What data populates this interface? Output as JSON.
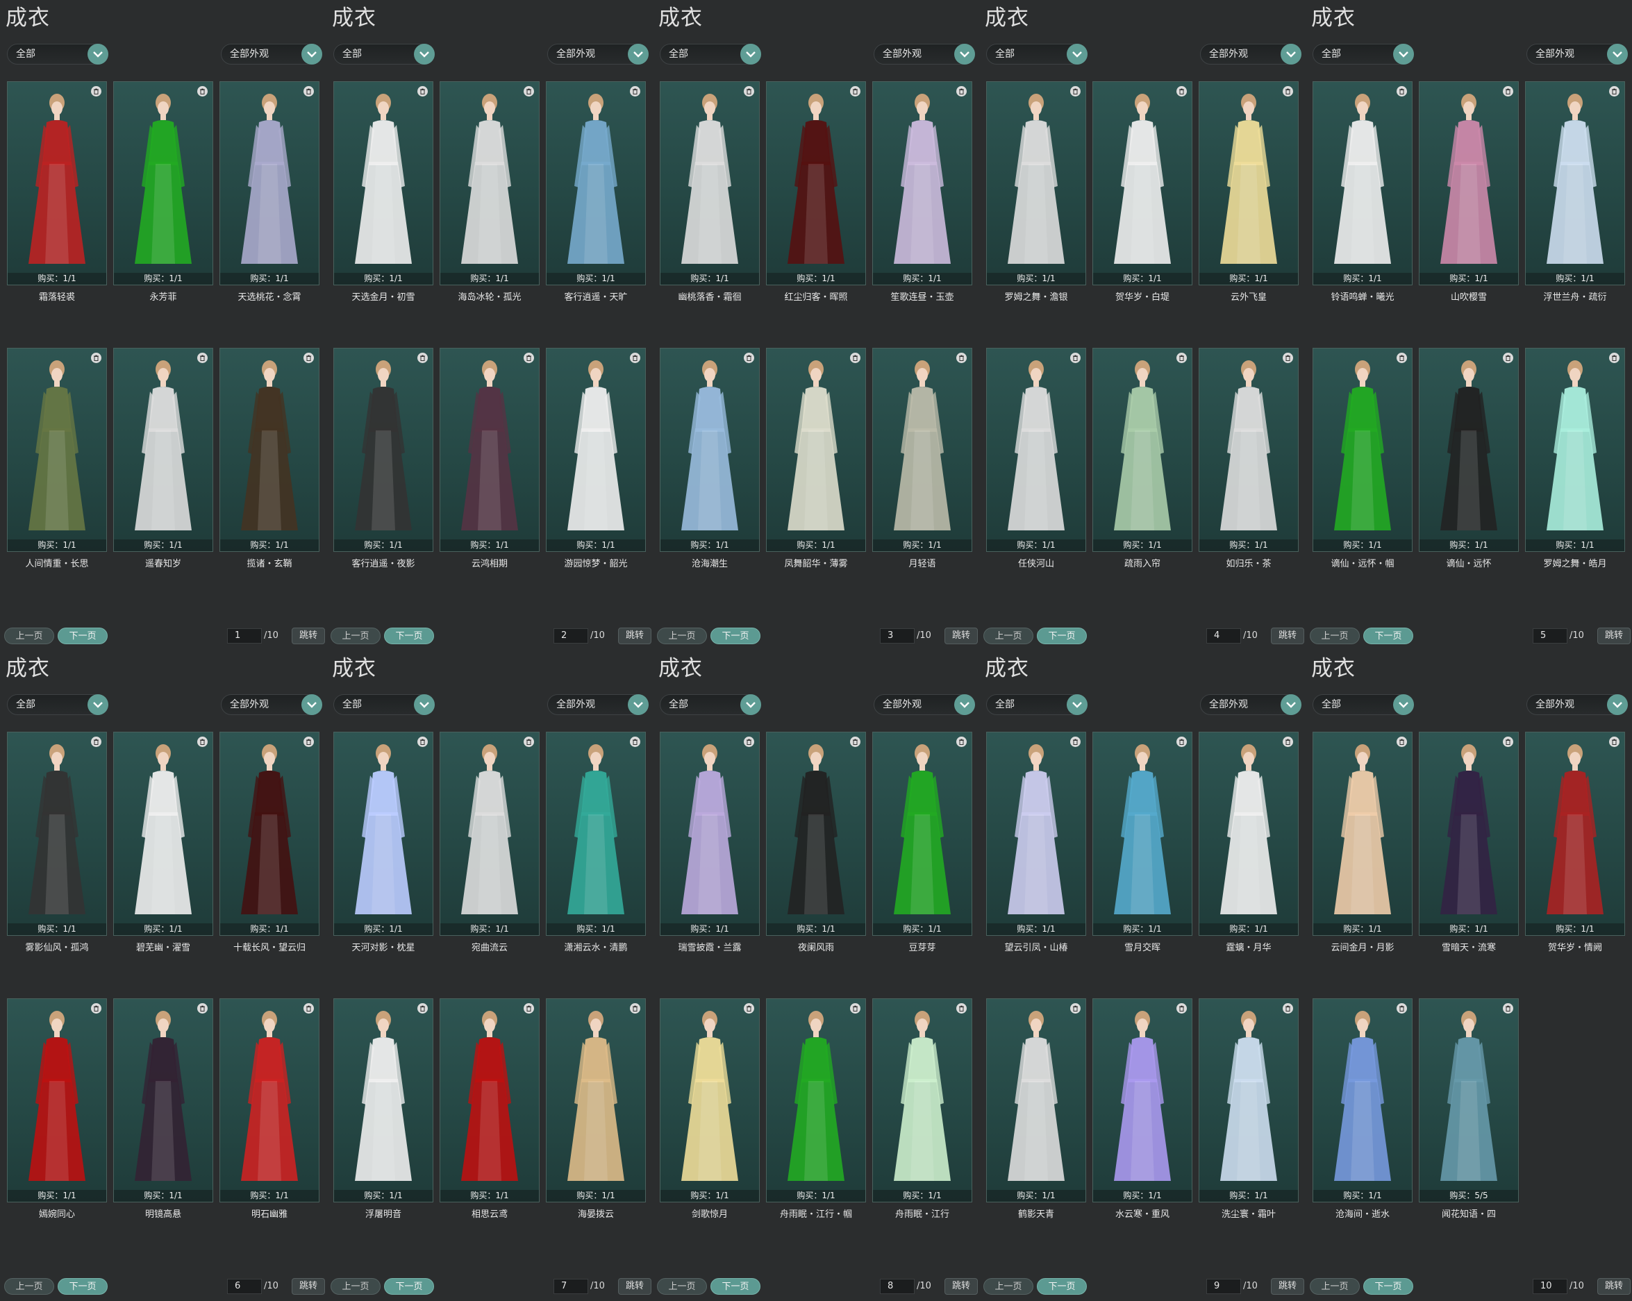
{
  "common": {
    "title": "成衣",
    "filter_all": "全部",
    "filter_appearance": "全部外观",
    "prev": "上一页",
    "next": "下一页",
    "jump": "跳转",
    "total": "/10"
  },
  "panels": [
    {
      "page": "1",
      "rows": [
        [
          {
            "n": "霜落轻裘",
            "b": "购买：1/1",
            "c": "#b22"
          },
          {
            "n": "永芳菲",
            "b": "购买：1/1",
            "c": "#2a2"
          },
          {
            "n": "天选桃花・念霄",
            "b": "购买：1/1",
            "c": "#aac"
          }
        ],
        [
          {
            "n": "人间情重・长思",
            "b": "购买：1/1",
            "c": "#674"
          },
          {
            "n": "遥春知岁",
            "b": "购买：1/1",
            "c": "#ddd"
          },
          {
            "n": "揽诸・玄鞘",
            "b": "购买：1/1",
            "c": "#432"
          }
        ]
      ]
    },
    {
      "page": "2",
      "rows": [
        [
          {
            "n": "天选金月・初雪",
            "b": "购买：1/1",
            "c": "#eee"
          },
          {
            "n": "海岛冰轮・孤光",
            "b": "购买：1/1",
            "c": "#ddd"
          },
          {
            "n": "客行逍遥・天旷",
            "b": "购买：1/1",
            "c": "#7ac"
          }
        ],
        [
          {
            "n": "客行逍遥・夜影",
            "b": "购买：1/1",
            "c": "#333"
          },
          {
            "n": "云鸿相期",
            "b": "购买：1/1",
            "c": "#534"
          },
          {
            "n": "游园惊梦・韶光",
            "b": "购买：1/1",
            "c": "#eee"
          }
        ]
      ]
    },
    {
      "page": "3",
      "rows": [
        [
          {
            "n": "幽桃落香・霜徊",
            "b": "购买：1/1",
            "c": "#ddd"
          },
          {
            "n": "红尘归客・晖照",
            "b": "购买：1/1",
            "c": "#511"
          },
          {
            "n": "笙歌连昼・玉壶",
            "b": "购买：1/1",
            "c": "#cbd"
          }
        ],
        [
          {
            "n": "沧海潮生",
            "b": "购买：1/1",
            "c": "#9bd"
          },
          {
            "n": "凤舞韶华・薄雾",
            "b": "购买：1/1",
            "c": "#ddc"
          },
          {
            "n": "月轻语",
            "b": "购买：1/1",
            "c": "#bba"
          }
        ]
      ]
    },
    {
      "page": "4",
      "rows": [
        [
          {
            "n": "罗姆之舞・澹银",
            "b": "购买：1/1",
            "c": "#ddd"
          },
          {
            "n": "贺华岁・白堤",
            "b": "购买：1/1",
            "c": "#eee"
          },
          {
            "n": "云外飞皇",
            "b": "购买：1/1",
            "c": "#ed9"
          }
        ],
        [
          {
            "n": "任侠河山",
            "b": "购买：1/1",
            "c": "#ddd"
          },
          {
            "n": "疏雨入帘",
            "b": "购买：1/1",
            "c": "#aca"
          },
          {
            "n": "如归乐・茶",
            "b": "购买：1/1",
            "c": "#ddd"
          }
        ]
      ]
    },
    {
      "page": "5",
      "rows": [
        [
          {
            "n": "铃语鸣蝉・曦光",
            "b": "购买：1/1",
            "c": "#eee"
          },
          {
            "n": "山吹樱雪",
            "b": "购买：1/1",
            "c": "#c8a"
          },
          {
            "n": "浮世兰舟・疏衍",
            "b": "购买：1/1",
            "c": "#cde"
          }
        ],
        [
          {
            "n": "谪仙・远怀・帼",
            "b": "购买：1/1",
            "c": "#2a2"
          },
          {
            "n": "谪仙・远怀",
            "b": "购买：1/1",
            "c": "#222"
          },
          {
            "n": "罗姆之舞・皓月",
            "b": "购买：1/1",
            "c": "#aed"
          }
        ]
      ]
    },
    {
      "page": "6",
      "rows": [
        [
          {
            "n": "雾影仙风・孤鸿",
            "b": "购买：1/1",
            "c": "#333"
          },
          {
            "n": "碧芜幽・濯雪",
            "b": "购买：1/1",
            "c": "#eee"
          },
          {
            "n": "十载长风・望云归",
            "b": "购买：1/1",
            "c": "#411"
          }
        ],
        [
          {
            "n": "嫣婉同心",
            "b": "购买：1/1",
            "c": "#b11"
          },
          {
            "n": "明镜高悬",
            "b": "购买：1/1",
            "c": "#323"
          },
          {
            "n": "明石幽雅",
            "b": "购买：1/1",
            "c": "#c22"
          }
        ]
      ]
    },
    {
      "page": "7",
      "rows": [
        [
          {
            "n": "天河对影・枕星",
            "b": "购买：1/1",
            "c": "#bcf"
          },
          {
            "n": "宛曲流云",
            "b": "购买：1/1",
            "c": "#ddd"
          },
          {
            "n": "潇湘云水・清鹏",
            "b": "购买：1/1",
            "c": "#3a9"
          }
        ],
        [
          {
            "n": "浮屠明音",
            "b": "购买：1/1",
            "c": "#eee"
          },
          {
            "n": "相思云鸢",
            "b": "购买：1/1",
            "c": "#b11"
          },
          {
            "n": "海晏拨云",
            "b": "购买：1/1",
            "c": "#db8"
          }
        ]
      ]
    },
    {
      "page": "8",
      "rows": [
        [
          {
            "n": "瑞雪披霞・兰露",
            "b": "购买：1/1",
            "c": "#bad"
          },
          {
            "n": "夜阑风雨",
            "b": "购买：1/1",
            "c": "#222"
          },
          {
            "n": "豆芽芽",
            "b": "购买：1/1",
            "c": "#2a2"
          }
        ],
        [
          {
            "n": "剑歌惊月",
            "b": "购买：1/1",
            "c": "#ed9"
          },
          {
            "n": "舟雨眠・江行・帼",
            "b": "购买：1/1",
            "c": "#2a2"
          },
          {
            "n": "舟雨眠・江行",
            "b": "购买：1/1",
            "c": "#cec"
          }
        ]
      ]
    },
    {
      "page": "9",
      "rows": [
        [
          {
            "n": "望云引凤・山椿",
            "b": "购买：1/1",
            "c": "#cce"
          },
          {
            "n": "雪月交晖",
            "b": "购买：1/1",
            "c": "#5ac"
          },
          {
            "n": "霆螭・月华",
            "b": "购买：1/1",
            "c": "#eee"
          }
        ],
        [
          {
            "n": "鹤影天青",
            "b": "购买：1/1",
            "c": "#ddd"
          },
          {
            "n": "水云寒・重风",
            "b": "购买：1/1",
            "c": "#a9e"
          },
          {
            "n": "洗尘寰・霜叶",
            "b": "购买：1/1",
            "c": "#cde"
          }
        ]
      ]
    },
    {
      "page": "10",
      "rows": [
        [
          {
            "n": "云间金月・月影",
            "b": "购买：1/1",
            "c": "#eca"
          },
          {
            "n": "雪暗天・流寒",
            "b": "购买：1/1",
            "c": "#324"
          },
          {
            "n": "贺华岁・情阙",
            "b": "购买：1/1",
            "c": "#a22"
          }
        ],
        [
          {
            "n": "沧海间・逝水",
            "b": "购买：1/1",
            "c": "#79d"
          },
          {
            "n": "闻花知语・四",
            "b": "购买：5/5",
            "c": "#69a"
          }
        ]
      ]
    }
  ]
}
